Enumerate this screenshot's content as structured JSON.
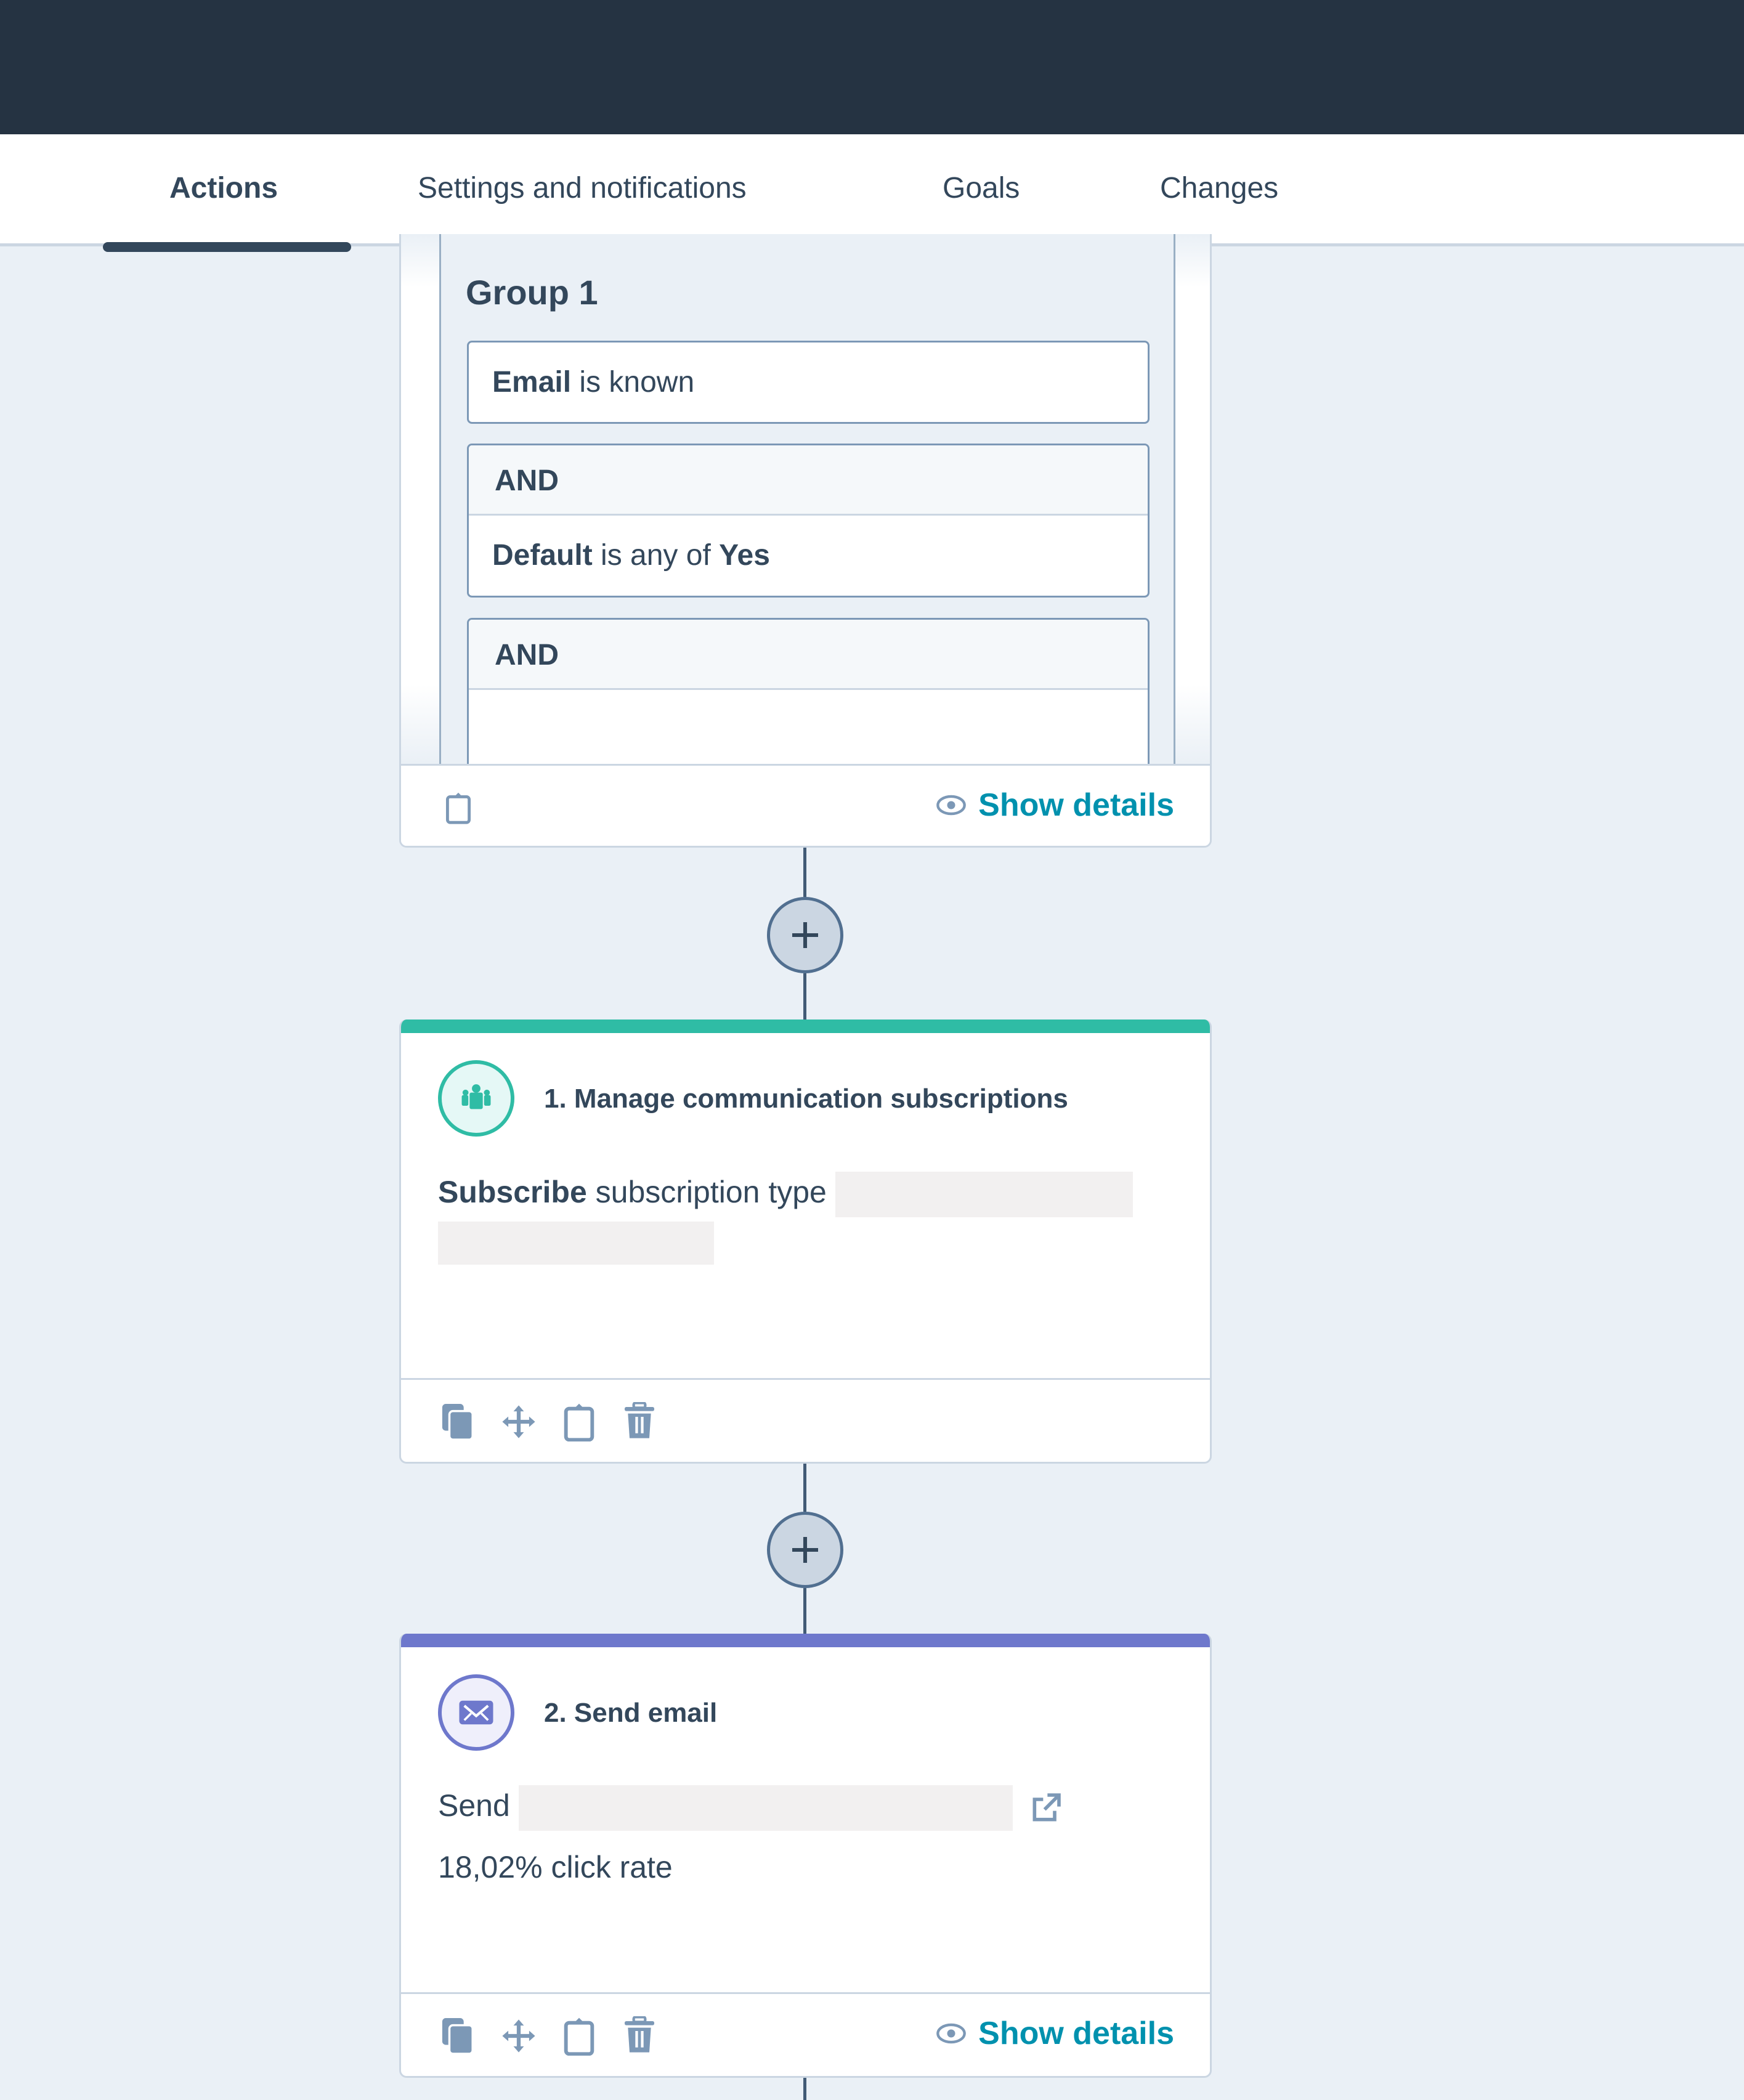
{
  "tabs": [
    {
      "label": "Actions",
      "active": true
    },
    {
      "label": "Settings and notifications",
      "active": false
    },
    {
      "label": "Goals",
      "active": false
    },
    {
      "label": "Changes",
      "active": false
    }
  ],
  "enrollment_card": {
    "group_title": "Group 1",
    "conditions": [
      {
        "property": "Email",
        "operator": "is known",
        "value": ""
      },
      {
        "joiner": "AND",
        "property": "Default",
        "operator": "is any of",
        "value": "Yes"
      },
      {
        "joiner": "AND",
        "property": "",
        "operator": "",
        "value": ""
      }
    ],
    "show_details_label": "Show details"
  },
  "actions": [
    {
      "title": "1. Manage communication subscriptions",
      "accent_color": "#2fbca5",
      "icon": "people-group-icon",
      "body_bold": "Subscribe",
      "body_text": "subscription type",
      "footer_icons": [
        "copy-icon",
        "move-icon",
        "clipboard-icon",
        "trash-icon"
      ]
    },
    {
      "title": "2. Send email",
      "accent_color": "#6e78cc",
      "icon": "envelope-icon",
      "body_prefix": "Send",
      "stat_text": "18,02% click rate",
      "footer_icons": [
        "copy-icon",
        "move-icon",
        "clipboard-icon",
        "trash-icon"
      ],
      "show_details_label": "Show details"
    }
  ],
  "colors": {
    "topbar": "#253342",
    "background": "#eaf0f6",
    "text": "#33475b",
    "link": "#0091ae",
    "icon_muted": "#7c98b6"
  }
}
